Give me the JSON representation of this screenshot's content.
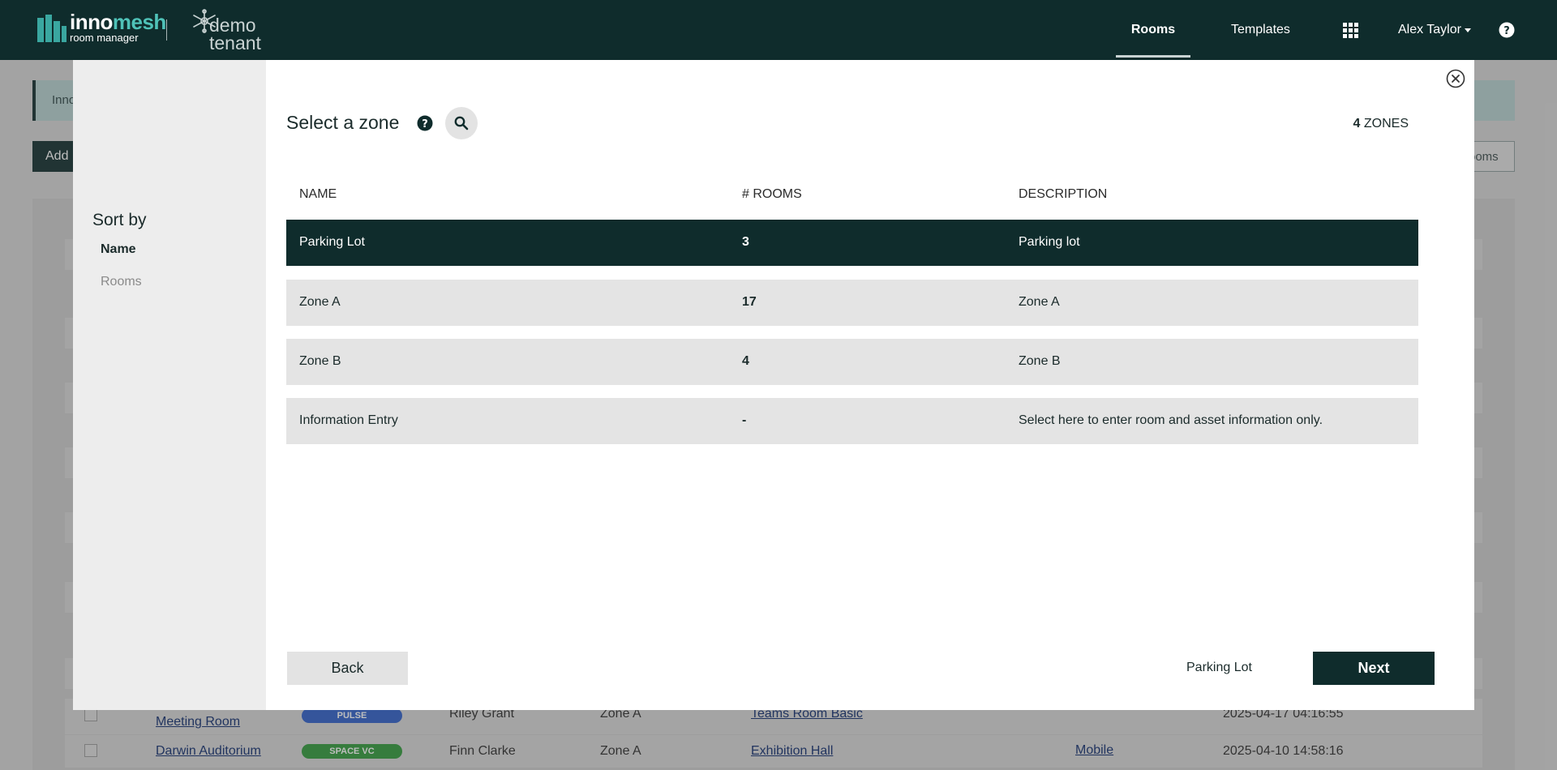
{
  "brand": {
    "name_part1": "inno",
    "name_part2": "mesh",
    "subtitle": "room manager",
    "tenant_line1": "demo",
    "tenant_line2": "tenant"
  },
  "nav": {
    "rooms": "Rooms",
    "templates": "Templates",
    "apps_icon": "grid-icon",
    "user": "Alex Taylor",
    "help_icon": "question-circle-icon"
  },
  "background": {
    "banner_text": "Inno",
    "add_button": "Add",
    "rooms_button": "ooms",
    "rows": [
      {
        "name": "Meeting Room",
        "badge": "PULSE",
        "badge_color": "#2d5fc9",
        "owner": "Riley Grant",
        "zone": "Zone A",
        "template": "Teams Room Basic",
        "extra": "",
        "date": "2025-04-17 04:16:55"
      },
      {
        "name": "Darwin Auditorium",
        "badge": "SPACE VC",
        "badge_color": "#2e9a3a",
        "owner": "Finn Clarke",
        "zone": "Zone A",
        "template": "Exhibition Hall",
        "extra": "Mobile",
        "date": "2025-04-10 14:58:16"
      }
    ]
  },
  "modal": {
    "sort_by_title": "Sort by",
    "sort_options": [
      "Name",
      "Rooms"
    ],
    "title": "Select a zone",
    "zone_count": "4",
    "zone_count_label": " ZONES",
    "columns": [
      "NAME",
      "# ROOMS",
      "DESCRIPTION"
    ],
    "zones": [
      {
        "name": "Parking Lot",
        "rooms": "3",
        "description": "Parking lot"
      },
      {
        "name": "Zone A",
        "rooms": "17",
        "description": "Zone A"
      },
      {
        "name": "Zone B",
        "rooms": "4",
        "description": "Zone B"
      },
      {
        "name": "Information Entry",
        "rooms": "-",
        "description": "Select here to enter room and asset information only."
      }
    ],
    "selected_zone": "Parking Lot",
    "back_button": "Back",
    "next_button": "Next"
  },
  "colors": {
    "primary_dark": "#0f2c2c",
    "accent_teal": "#3aa7a0"
  }
}
